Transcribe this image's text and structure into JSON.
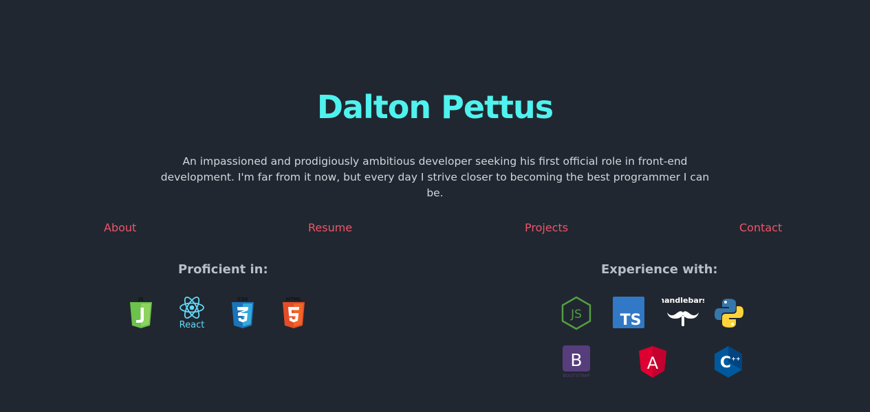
{
  "header": {
    "name": "Dalton Pettus",
    "bio": "An impassioned and prodigiously ambitious developer seeking his first official role in front-end development. I'm far from it now, but every day I strive closer to becoming the best programmer I can be."
  },
  "nav": {
    "about": "About",
    "resume": "Resume",
    "projects": "Projects",
    "contact": "Contact"
  },
  "proficient": {
    "title": "Proficient in:",
    "logos": [
      {
        "icon": "javascript-icon",
        "label": "JS",
        "color": "#6cc24a"
      },
      {
        "icon": "react-icon",
        "label": "React",
        "color": "#61dafb"
      },
      {
        "icon": "css3-icon",
        "label": "CSS",
        "color": "#1b73ba"
      },
      {
        "icon": "html5-icon",
        "label": "HTML",
        "color": "#e44d26"
      }
    ]
  },
  "experience": {
    "title": "Experience with:",
    "logos": [
      {
        "icon": "nodejs-icon",
        "label": "JS",
        "color": "#539e43"
      },
      {
        "icon": "typescript-icon",
        "label": "TS",
        "color": "#3178c6"
      },
      {
        "icon": "handlebars-icon",
        "label": "handlebars",
        "color": "#ffffff"
      },
      {
        "icon": "python-icon",
        "color": "#3776ab"
      },
      {
        "icon": "bootstrap-icon",
        "label": "B",
        "sublabel": "BOOTSTRAP",
        "color": "#563d7c"
      },
      {
        "icon": "angular-icon",
        "label": "A",
        "color": "#dd0031"
      },
      {
        "icon": "cplusplus-icon",
        "label": "C",
        "color": "#00599c"
      }
    ]
  }
}
